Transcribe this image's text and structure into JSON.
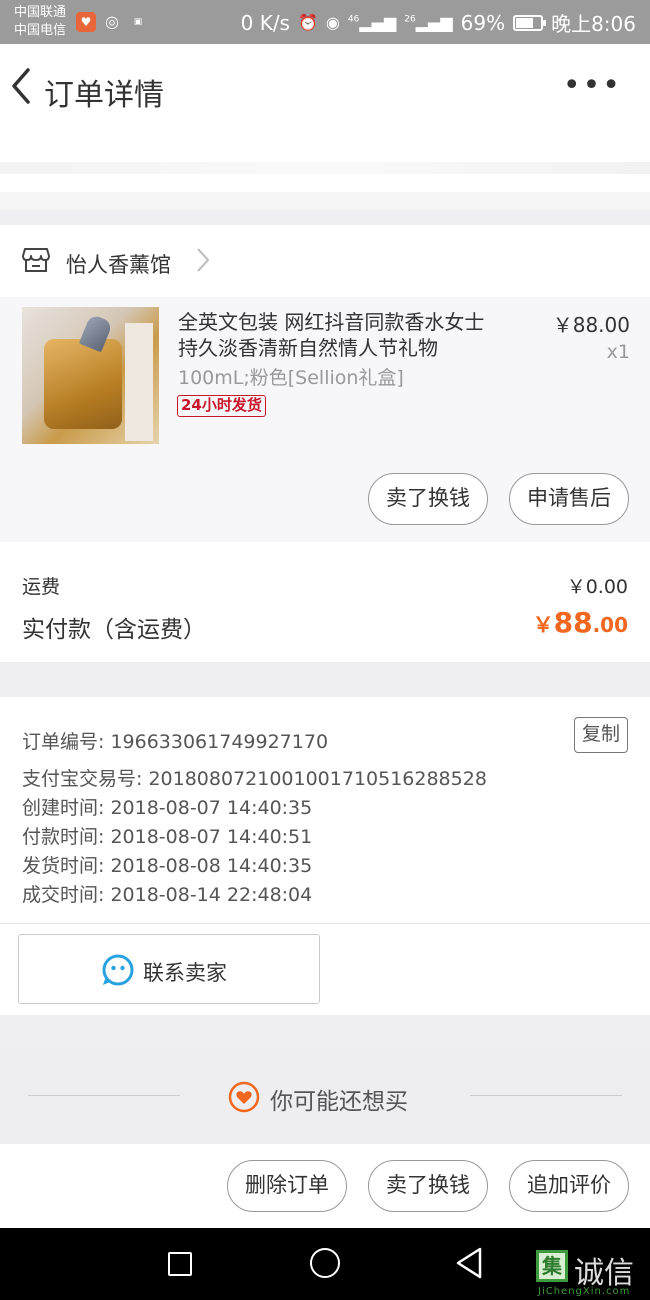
{
  "status_bar": {
    "carrier_1": "中国联通",
    "carrier_2": "中国电信",
    "network_speed": "0 K/s",
    "signal_1_label": "46",
    "signal_2_label": "26",
    "battery": "69%",
    "battery_level": 0.69,
    "time": "晚上8:06"
  },
  "nav": {
    "title": "订单详情",
    "more": "•••"
  },
  "shop": {
    "name": "怡人香薰馆"
  },
  "product": {
    "title": "全英文包装 网红抖音同款香水女士持久淡香清新自然情人节礼物",
    "spec": "100mL;粉色[Sellion礼盒]",
    "badge": "24小时发货",
    "price": "￥88.00",
    "quantity": "x1",
    "actions": [
      "卖了换钱",
      "申请售后"
    ]
  },
  "fees": {
    "shipping_label": "运费",
    "shipping_value": "￥0.00",
    "paid_label": "实付款（含运费）",
    "paid_symbol": "￥",
    "paid_int": "88",
    "paid_dec": ".00"
  },
  "order_info": {
    "copy_label": "复制",
    "lines": [
      "订单编号: 196633061749927170",
      "支付宝交易号: 2018080721001001710516288528",
      "创建时间: 2018-08-07 14:40:35",
      "付款时间: 2018-08-07 14:40:51",
      "发货时间: 2018-08-08 14:40:35",
      "成交时间: 2018-08-14 22:48:04"
    ]
  },
  "contact": {
    "label": "联系卖家"
  },
  "recommend": {
    "label": "你可能还想买"
  },
  "bottom_actions": [
    "删除订单",
    "卖了换钱",
    "追加评价"
  ],
  "watermark": {
    "logo_char": "集",
    "text": "诚信",
    "sub": "JiChengXin.com"
  },
  "colors": {
    "accent": "#f2671f",
    "badge_red": "#c8162c",
    "contact_blue": "#29a3e0"
  }
}
